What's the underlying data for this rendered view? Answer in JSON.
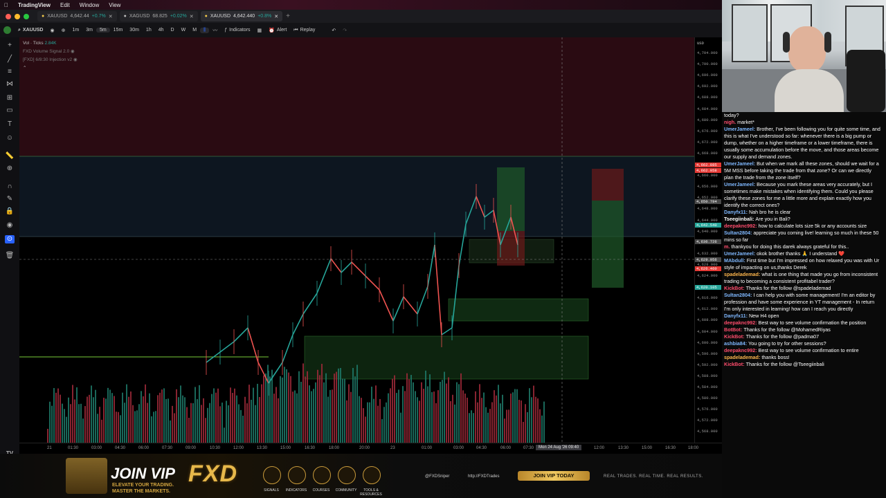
{
  "menubar": {
    "apple": "",
    "app": "TradingView",
    "items": [
      "Edit",
      "Window",
      "View"
    ]
  },
  "tabs": [
    {
      "symbol": "XAUUSD",
      "price": "4,642.44",
      "change": "+0.7%"
    },
    {
      "symbol": "XAGUSD",
      "price": "68.825",
      "change": "+0.02%"
    },
    {
      "symbol": "XAUUSD",
      "price": "4,642.440",
      "change": "+0.8%"
    }
  ],
  "toolbar": {
    "symbol": "XAUUSD",
    "intervals": [
      "1m",
      "3m",
      "5m",
      "15m",
      "30m",
      "1h",
      "4h",
      "D",
      "W",
      "M"
    ],
    "selected_interval": "5m",
    "indicators": "Indicators",
    "alert": "Alert",
    "replay": "Replay"
  },
  "legend": {
    "vol_label": "Vol · Ticks",
    "vol_value": "2.84K",
    "line2": "FXD Volume Signal 2.0",
    "line3": "[FXD] 6/8:30 Injection v2"
  },
  "price_axis": {
    "currency": "USD",
    "labels": [
      "4,704.000",
      "4,700.000",
      "4,696.000",
      "4,692.000",
      "4,688.000",
      "4,684.000",
      "4,680.000",
      "4,676.000",
      "4,672.000",
      "4,668.000",
      "4,664.000",
      "4,660.000",
      "4,656.000",
      "4,652.000",
      "4,648.000",
      "4,644.000",
      "4,640.000",
      "4,636.000",
      "4,632.000",
      "4,628.000",
      "4,624.000",
      "4,620.000",
      "4,616.000",
      "4,612.000",
      "4,608.000",
      "4,604.000",
      "4,600.000",
      "4,596.000",
      "4,592.000",
      "4,588.000",
      "4,584.000",
      "4,580.000",
      "4,576.000",
      "4,572.000",
      "4,568.000"
    ],
    "tags": [
      {
        "value": "4,662.885",
        "color": "#e53935"
      },
      {
        "value": "4,662.058",
        "color": "#e53935"
      },
      {
        "value": "4,650.784",
        "color": "#4a4a4a"
      },
      {
        "value": "4,642.540",
        "color": "#26a69a"
      },
      {
        "value": "4,636.726",
        "color": "#4a4a4a"
      },
      {
        "value": "4,629.956",
        "color": "#4a4a4a"
      },
      {
        "value": "4,626.460",
        "color": "#e53935"
      },
      {
        "value": "4,620.105",
        "color": "#26a69a"
      }
    ]
  },
  "time_axis": {
    "labels": [
      "21",
      "01:30",
      "03:00",
      "04:30",
      "06:00",
      "07:30",
      "09:00",
      "10:30",
      "12:00",
      "13:30",
      "15:00",
      "16:30",
      "18:00",
      "20:00",
      "23",
      "01:00",
      "03:00",
      "04:30",
      "06:00",
      "07:30",
      "12:00",
      "13:30",
      "15:00",
      "16:30",
      "18:00"
    ],
    "crosshair_label": "Mon 24 Aug '26  09:40"
  },
  "banner": {
    "join_vip": "JOIN VIP",
    "tagline1": "ELEVATE YOUR TRADING.",
    "tagline2": "MASTER THE MARKETS.",
    "logo": "FXD",
    "icons": [
      "SIGNALS",
      "INDICATORS",
      "COURSES",
      "COMMUNITY",
      "TOOLS & RESOURCES"
    ],
    "handle1": "@FXDSniper",
    "handle2": "http://FXDTrades",
    "cta": "JOIN VIP TODAY",
    "slogan": "REAL TRADES. REAL TIME. REAL RESULTS."
  },
  "chat": [
    {
      "user": "",
      "text": "today?",
      "color": "#ffffff"
    },
    {
      "user": "nigh.",
      "text": "market*",
      "color": "#ff4d6d"
    },
    {
      "user": "UmerJameel:",
      "text": "Brother, I've been following you for quite some time, and this is what I've understood so far: whenever there is a big pump or dump, whether on a higher timeframe or a lower timeframe, there is usually some accumulation before the move, and those areas become our supply and demand zones.",
      "color": "#7fb8ff"
    },
    {
      "user": "UmerJameel:",
      "text": "But when we mark all these zones, should we wait for a 5M MSS before taking the trade from that zone? Or can we directly plan the trade from the zone itself?",
      "color": "#7fb8ff"
    },
    {
      "user": "UmerJameel:",
      "text": "Because you mark these areas very accurately, but I sometimes make mistakes when identifying them. Could you please clarify these zones for me a little more and explain exactly how you identify the correct ones?",
      "color": "#7fb8ff"
    },
    {
      "user": "Danyfx11:",
      "text": "Nah bro he is clear",
      "color": "#7fb8ff"
    },
    {
      "user": "Tseegiinbali:",
      "text": "Are you in Bali?",
      "color": "#ffffff"
    },
    {
      "user": "deepaknc992:",
      "text": "how to calculate lots size 5k or any accounts size",
      "color": "#ff4d6d"
    },
    {
      "user": "Sultan2804:",
      "text": "appreciate you coming live! learning so much in these 50 mins so far",
      "color": "#7fb8ff"
    },
    {
      "user": "m.",
      "text": "thankyou for doing this darek always grateful for this..",
      "color": "#ff4d6d"
    },
    {
      "user": "UmerJameel:",
      "text": "okok brother thanks 🙏 I understand ❤️",
      "color": "#7fb8ff"
    },
    {
      "user": "MAbdull:",
      "text": "First time but I'm impressed on how relaxed you was with Ur style of impacting on us,thanks Derek",
      "color": "#7fb8ff"
    },
    {
      "user": "spadelademad:",
      "text": "what is one thing that made you go from inconsistent trading to becoming a consistent profitabel trader?",
      "color": "#ffb74d"
    },
    {
      "user": "KickBot:",
      "text": "Thanks for the follow @spadelademad",
      "color": "#ff4d6d"
    },
    {
      "user": "Sultan2804:",
      "text": "I can help you with some management! I'm an editor by profession and have some experience in YT management - In return I'm only interested in learning! how can I reach you directly",
      "color": "#7fb8ff"
    },
    {
      "user": "Danyfx11:",
      "text": "New H4 open",
      "color": "#7fb8ff"
    },
    {
      "user": "deepaknc992:",
      "text": "Best way to see volume confirmation the position",
      "color": "#ff4d6d"
    },
    {
      "user": "BotBot:",
      "text": "Thanks for the follow @MohamedRiyas",
      "color": "#ff4d6d"
    },
    {
      "user": "KickBot:",
      "text": "Thanks for the follow @padma07",
      "color": "#ff4d6d"
    },
    {
      "user": "ashbia84:",
      "text": "You going to try for other sessions?",
      "color": "#7fb8ff"
    },
    {
      "user": "deepaknc992:",
      "text": "Best way to see volume confirmation to entire",
      "color": "#ff4d6d"
    },
    {
      "user": "spadelademad:",
      "text": "thanks boss!",
      "color": "#ffb74d"
    },
    {
      "user": "KickBot:",
      "text": "Thanks for the follow @Tseegiinbali",
      "color": "#ff4d6d"
    }
  ]
}
